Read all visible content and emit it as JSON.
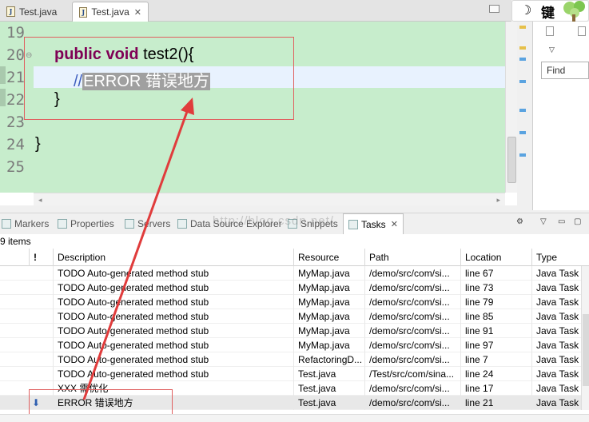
{
  "tabs": [
    {
      "label": "Test.java",
      "active": false
    },
    {
      "label": "Test.java",
      "active": true
    }
  ],
  "editor": {
    "line_numbers": [
      "19",
      "20",
      "21",
      "22",
      "23",
      "24",
      "25"
    ],
    "lines": {
      "l20_kw": "public void",
      "l20_rest": " test2(){",
      "l21_slashes": "//",
      "l21_selected": "ERROR 错误地方",
      "l22": "}",
      "l24": "}"
    }
  },
  "widget": {
    "key_label": "键"
  },
  "right_panel": {
    "find_label": "Find"
  },
  "view_tabs": [
    {
      "label": "Markers"
    },
    {
      "label": "Properties"
    },
    {
      "label": "Servers"
    },
    {
      "label": "Data Source Explorer"
    },
    {
      "label": "Snippets"
    },
    {
      "label": "Tasks",
      "active": true
    }
  ],
  "watermark": "http://blog.csdn.net/",
  "tasks": {
    "item_count": "9 items",
    "columns": [
      "!",
      "Description",
      "Resource",
      "Path",
      "Location",
      "Type"
    ],
    "rows": [
      {
        "priority": "",
        "description": "TODO Auto-generated method stub",
        "resource": "MyMap.java",
        "path": "/demo/src/com/si...",
        "location": "line 67",
        "type": "Java Task"
      },
      {
        "priority": "",
        "description": "TODO Auto-generated method stub",
        "resource": "MyMap.java",
        "path": "/demo/src/com/si...",
        "location": "line 73",
        "type": "Java Task"
      },
      {
        "priority": "",
        "description": "TODO Auto-generated method stub",
        "resource": "MyMap.java",
        "path": "/demo/src/com/si...",
        "location": "line 79",
        "type": "Java Task"
      },
      {
        "priority": "",
        "description": "TODO Auto-generated method stub",
        "resource": "MyMap.java",
        "path": "/demo/src/com/si...",
        "location": "line 85",
        "type": "Java Task"
      },
      {
        "priority": "",
        "description": "TODO Auto-generated method stub",
        "resource": "MyMap.java",
        "path": "/demo/src/com/si...",
        "location": "line 91",
        "type": "Java Task"
      },
      {
        "priority": "",
        "description": "TODO Auto-generated method stub",
        "resource": "MyMap.java",
        "path": "/demo/src/com/si...",
        "location": "line 97",
        "type": "Java Task"
      },
      {
        "priority": "",
        "description": "TODO Auto-generated method stub",
        "resource": "RefactoringD...",
        "path": "/demo/src/com/si...",
        "location": "line 7",
        "type": "Java Task"
      },
      {
        "priority": "",
        "description": "TODO Auto-generated method stub",
        "resource": "Test.java",
        "path": "/Test/src/com/sina...",
        "location": "line 24",
        "type": "Java Task"
      },
      {
        "priority": "",
        "description": "XXX 需优化",
        "resource": "Test.java",
        "path": "/demo/src/com/si...",
        "location": "line 17",
        "type": "Java Task"
      },
      {
        "priority": "low",
        "description": "ERROR 错误地方",
        "resource": "Test.java",
        "path": "/demo/src/com/si...",
        "location": "line 21",
        "type": "Java Task"
      }
    ]
  },
  "colors": {
    "annotation": "#e03c3c",
    "editor_bg": "#c7edcc",
    "keyword": "#7f0055",
    "comment": "#3f5fbf"
  }
}
